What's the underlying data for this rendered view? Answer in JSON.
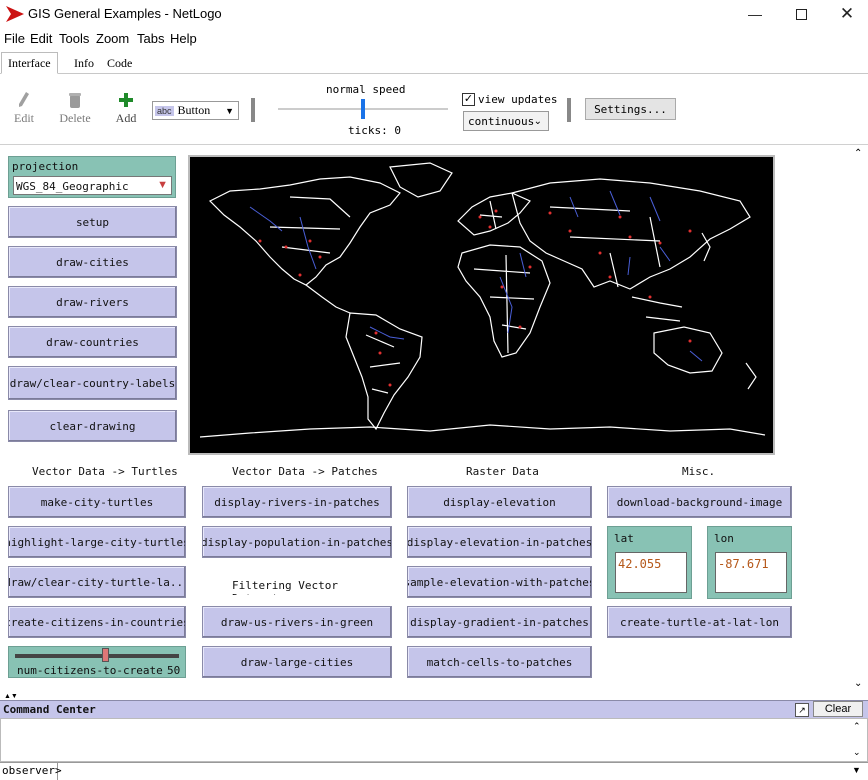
{
  "window": {
    "title": "GIS General Examples - NetLogo"
  },
  "menubar": {
    "items": [
      "File",
      "Edit",
      "Tools",
      "Zoom",
      "Tabs",
      "Help"
    ]
  },
  "tabs": [
    "Interface",
    "Info",
    "Code"
  ],
  "toolbar": {
    "edit": "Edit",
    "delete": "Delete",
    "add": "Add",
    "widget_type": "Button",
    "widget_type_tag": "abc",
    "speed_label": "normal speed",
    "speed_value": 0.5,
    "ticks_label": "ticks: 0",
    "view_updates_label": "view updates",
    "view_updates_checked": true,
    "update_mode": "continuous",
    "settings": "Settings..."
  },
  "left_panel": {
    "projection_label": "projection",
    "projection_value": "WGS_84_Geographic",
    "buttons": [
      "setup",
      "draw-cities",
      "draw-rivers",
      "draw-countries",
      "draw/clear-country-labels",
      "clear-drawing"
    ]
  },
  "sections": {
    "col1": {
      "heading": "Vector Data -> Turtles",
      "buttons": [
        "make-city-turtles",
        "highlight-large-city-turtles",
        "draw/clear-city-turtle-la...",
        "create-citizens-in-countries"
      ]
    },
    "col2": {
      "heading": "Vector Data -> Patches",
      "buttons": [
        "display-rivers-in-patches",
        "display-population-in-patches",
        "draw-us-rivers-in-green",
        "draw-large-cities"
      ],
      "note": "Filtering Vector Datasets"
    },
    "col3": {
      "heading": "Raster Data",
      "buttons": [
        "display-elevation",
        "display-elevation-in-patches",
        "sample-elevation-with-patches",
        "display-gradient-in-patches",
        "match-cells-to-patches"
      ]
    },
    "col4": {
      "heading": "Misc.",
      "buttons": [
        "download-background-image",
        "create-turtle-at-lat-lon"
      ]
    }
  },
  "slider": {
    "label": "num-citizens-to-create",
    "value": "50",
    "fraction": 0.55
  },
  "inputs": {
    "lat_label": "lat",
    "lat_value": "42.055",
    "lon_label": "lon",
    "lon_value": "-87.671"
  },
  "command_center": {
    "title": "Command Center",
    "clear": "Clear",
    "prompt": "observer>"
  },
  "colors": {
    "button": "#c5c5ea",
    "input_box": "#88c2b4",
    "rivers": "#4a5fd8",
    "cities": "#e03030",
    "borders": "#ffffff"
  }
}
